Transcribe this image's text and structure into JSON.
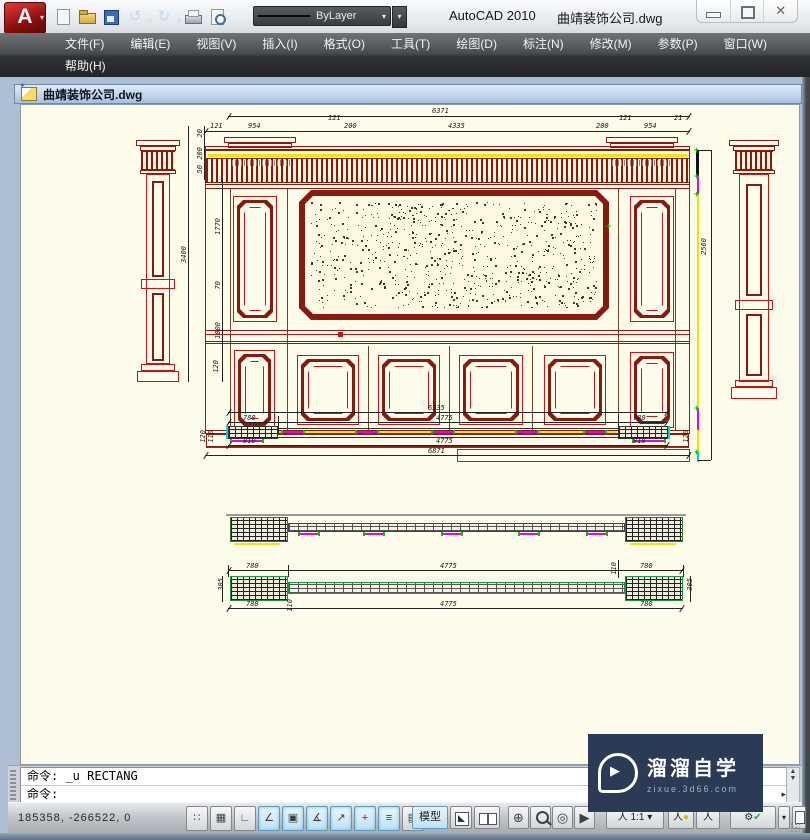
{
  "app": {
    "product": "AutoCAD 2010",
    "document": "曲靖装饰公司.dwg"
  },
  "quick_access": {
    "linetype": "ByLayer"
  },
  "menus": {
    "row1": [
      "文件(F)",
      "编辑(E)",
      "视图(V)",
      "插入(I)",
      "格式(O)",
      "工具(T)",
      "绘图(D)",
      "标注(N)",
      "修改(M)",
      "参数(P)",
      "窗口(W)"
    ],
    "row2": [
      "帮助(H)"
    ]
  },
  "document": {
    "tab_title": "曲靖装饰公司.dwg"
  },
  "dims": {
    "ev_total_w": "6371",
    "ev_top": [
      "121",
      "954",
      "121",
      "200",
      "4335",
      "200",
      "121",
      "954",
      "21"
    ],
    "ev_left": [
      "20",
      "200",
      "50",
      "1770",
      "70",
      "1000",
      "120"
    ],
    "ev_left_total": "3400",
    "ev_right_h": "2560",
    "p1_total_top": "6335",
    "p1_top": [
      "780",
      "4775",
      "780"
    ],
    "p1_bot": [
      "810",
      "4775",
      "810"
    ],
    "p1_total_bot": "6871",
    "p1_side": [
      "120",
      "110"
    ],
    "p1_side_r": "120",
    "p3_top": [
      "780",
      "4775",
      "780"
    ],
    "p3_top_small": "110",
    "p3_bot": [
      "780",
      "110",
      "4775",
      "780"
    ],
    "p3_side_l": "305",
    "p3_side_r": "305"
  },
  "command": {
    "prompt_history": "命令: _u RECTANG",
    "prompt_current": "命令:"
  },
  "status": {
    "coords": "185358, -266522, 0",
    "toggles": [
      {
        "name": "snap",
        "glyph": "∷",
        "on": false
      },
      {
        "name": "grid",
        "glyph": "▦",
        "on": false
      },
      {
        "name": "ortho",
        "glyph": "∟",
        "on": false
      },
      {
        "name": "polar",
        "glyph": "∠",
        "on": true
      },
      {
        "name": "osnap",
        "glyph": "▣",
        "on": true
      },
      {
        "name": "otrack",
        "glyph": "∡",
        "on": true
      },
      {
        "name": "ducs",
        "glyph": "↗",
        "on": true
      },
      {
        "name": "dyn",
        "glyph": "+",
        "on": true
      },
      {
        "name": "lwt",
        "glyph": "≡",
        "on": true
      },
      {
        "name": "qp",
        "glyph": "▤",
        "on": false
      }
    ],
    "model_label": "模型",
    "scale_person": "人",
    "scale_value": "1:1"
  },
  "watermark": {
    "title": "溜溜自学",
    "url": "zixue.3d66.com"
  },
  "colors": {
    "canvas": "#fdfbe9",
    "dark_red": "#8a1a0e",
    "red": "#c81414",
    "yellow": "#f0e400",
    "magenta": "#e800e8",
    "green": "#00c400",
    "cyan": "#00d8d8"
  }
}
